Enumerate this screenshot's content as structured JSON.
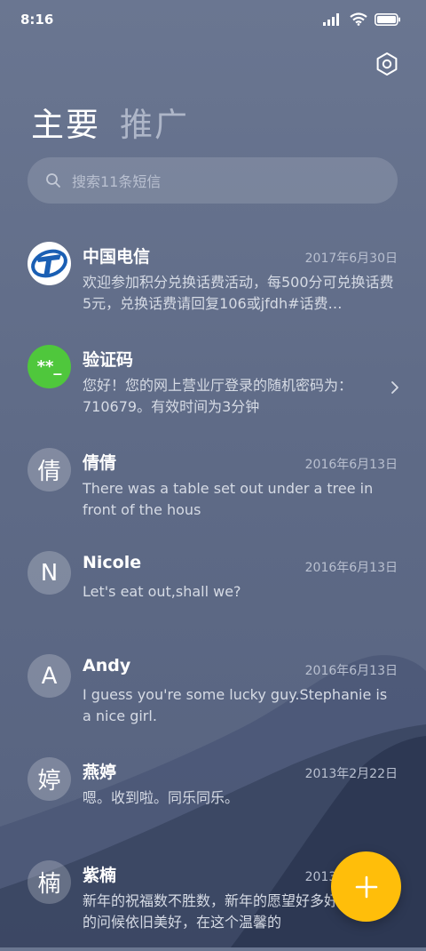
{
  "status_bar": {
    "time": "8:16",
    "icons": [
      "signal-icon",
      "wifi-icon",
      "battery-icon"
    ]
  },
  "header": {
    "settings_icon": "settings-icon"
  },
  "tabs": [
    {
      "label": "主要",
      "active": true
    },
    {
      "label": "推广",
      "active": false
    }
  ],
  "search": {
    "placeholder": "搜索11条短信",
    "icon": "search-icon"
  },
  "conversations": [
    {
      "avatar_type": "telecom",
      "avatar_text": "",
      "name": "中国电信",
      "date": "2017年6月30日",
      "preview": "欢迎参加积分兑换话费活动，每500分可兑换话费5元，兑换话费请回复106或jfdh#话费…"
    },
    {
      "avatar_type": "green",
      "avatar_text": "**_",
      "name": "验证码",
      "date": "",
      "preview": "您好！您的网上营业厅登录的随机密码为：710679。有效时间为3分钟",
      "chevron": true
    },
    {
      "avatar_type": "letter",
      "avatar_text": "倩",
      "name": "倩倩",
      "date": "2016年6月13日",
      "preview": "There was a table set out under a tree in front of the hous"
    },
    {
      "avatar_type": "letter",
      "avatar_text": "N",
      "name": "Nicole",
      "date": "2016年6月13日",
      "preview": "Let's eat out,shall we?"
    },
    {
      "avatar_type": "letter",
      "avatar_text": "A",
      "name": "Andy",
      "date": "2016年6月13日",
      "preview": "I guess you're some lucky guy.Stephanie is a nice girl."
    },
    {
      "avatar_type": "letter",
      "avatar_text": "婷",
      "name": "燕婷",
      "date": "2013年2月22日",
      "preview": "嗯。收到啦。同乐同乐。"
    },
    {
      "avatar_type": "letter",
      "avatar_text": "楠",
      "name": "紫楠",
      "date": "2013年2月22日",
      "preview": "新年的祝福数不胜数，新年的愿望好多好多，新年的问候依旧美好，在这个温馨的"
    }
  ],
  "fab": {
    "icon": "plus-icon",
    "color": "#ffbe0a"
  },
  "colors": {
    "background": "#65718d",
    "fab": "#ffbe0a",
    "verification_avatar": "#4fc73c"
  }
}
